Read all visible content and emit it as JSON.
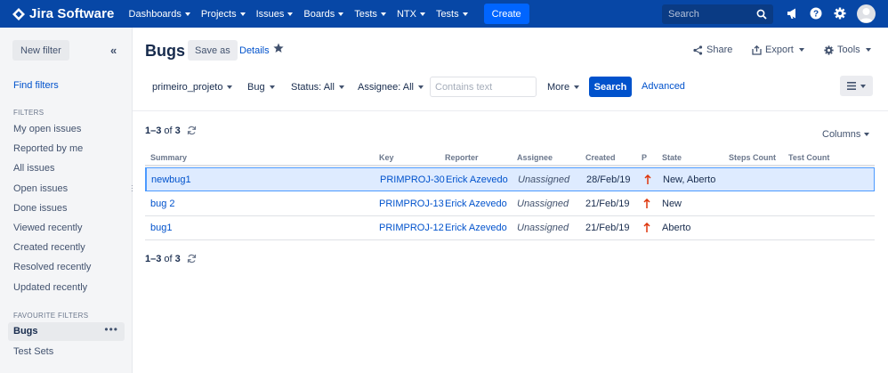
{
  "nav": {
    "app_name": "Jira Software",
    "menus": [
      "Dashboards",
      "Projects",
      "Issues",
      "Boards",
      "Tests",
      "NTX",
      "Tests"
    ],
    "create_label": "Create",
    "search_placeholder": "Search",
    "brand_color": "#0747a6",
    "icons": [
      "megaphone-icon",
      "help-icon",
      "settings-icon",
      "user-avatar"
    ]
  },
  "sidebar": {
    "new_filter_label": "New filter",
    "collapse_glyph": "«",
    "find_filters": "Find filters",
    "filters_heading": "FILTERS",
    "filters": [
      "My open issues",
      "Reported by me",
      "All issues",
      "Open issues",
      "Done issues",
      "Viewed recently",
      "Created recently",
      "Resolved recently",
      "Updated recently"
    ],
    "favourites_heading": "FAVOURITE FILTERS",
    "favourites": [
      "Bugs",
      "Test Sets"
    ],
    "selected_favourite": "Bugs",
    "more_glyph": "•••"
  },
  "header": {
    "title": "Bugs",
    "save_as": "Save as",
    "details": "Details",
    "share": "Share",
    "export": "Export",
    "tools": "Tools"
  },
  "filters": {
    "project": "primeiro_projeto",
    "type": "Bug",
    "status": "Status: All",
    "assignee": "Assignee: All",
    "text_placeholder": "Contains text",
    "more": "More",
    "search": "Search",
    "advanced": "Advanced"
  },
  "results": {
    "range": "1–3",
    "of": "of",
    "total": "3",
    "columns_label": "Columns"
  },
  "table": {
    "headers": [
      "Summary",
      "Key",
      "Reporter",
      "Assignee",
      "Created",
      "P",
      "State",
      "Steps Count",
      "Test Count"
    ],
    "rows": [
      {
        "summary": "newbug1",
        "key": "PRIMPROJ-30",
        "reporter": "Erick Azevedo",
        "assignee": "Unassigned",
        "created": "28/Feb/19",
        "priority": "high-priority-icon",
        "state": "New, Aberto",
        "steps": "",
        "tests": "",
        "selected": true
      },
      {
        "summary": "bug 2",
        "key": "PRIMPROJ-13",
        "reporter": "Erick Azevedo",
        "assignee": "Unassigned",
        "created": "21/Feb/19",
        "priority": "high-priority-icon",
        "state": "New",
        "steps": "",
        "tests": "",
        "selected": false
      },
      {
        "summary": "bug1",
        "key": "PRIMPROJ-12",
        "reporter": "Erick Azevedo",
        "assignee": "Unassigned",
        "created": "21/Feb/19",
        "priority": "high-priority-icon",
        "state": "Aberto",
        "steps": "",
        "tests": "",
        "selected": false
      }
    ]
  }
}
